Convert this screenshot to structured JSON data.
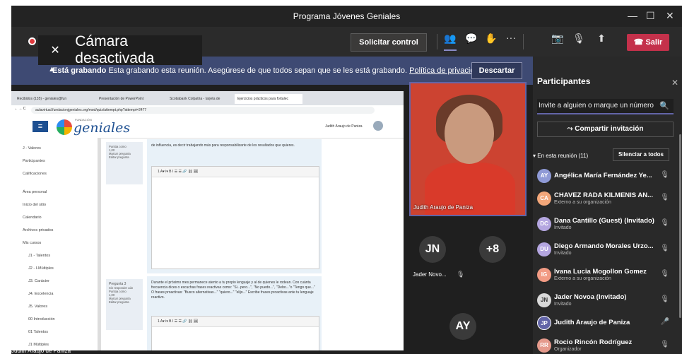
{
  "window": {
    "title": "Programa Jóvenes Geniales",
    "minimize": "—",
    "maximize": "☐",
    "close": "✕"
  },
  "camera_notice": "Cámara desactivada",
  "toolbar": {
    "request_control": "Solicitar control",
    "more": "···",
    "leave": "Salir"
  },
  "recording_banner": {
    "bold": "Está grabando",
    "text": "Esta grabando esta reunión. Asegúrese de que todos sepan que se les está grabando.",
    "link": "Política de privacidad",
    "dismiss": "Descartar"
  },
  "shared_screen": {
    "tabs": [
      "Recibidos (135) - geniales@fun",
      "Presentación de PowerPoint",
      "Scotiabank Colpatria - tarjeta de",
      "Ejercicios prácticos para fortalec"
    ],
    "url": "aulavirtual.fundacionjgeniales.org/mod/quiz/attempt.php?attempt=2477",
    "logo_top": "FUNDACIÓN",
    "logo": "geniales",
    "header_user": "Judith Araujo de Paniza",
    "sidebar": [
      "J - Valores",
      "Participantes",
      "Calificaciones",
      "Área personal",
      "Inicio del sitio",
      "Calendario",
      "Archivos privados",
      "Mis cursos",
      "J1 - Talentos",
      "J2 - I-Múltiples",
      "J3. Carácter",
      "J4. Excelencia",
      "J5. Valores",
      "00 Introducción",
      "01 Talentos",
      "J1 Múltiples"
    ],
    "q1_meta": [
      "Puntúa como",
      "1,00",
      "Marcar pregunta",
      "Editar pregunta"
    ],
    "q1_text": "de influencia, es decir trabajando más para responsabilizarte de los resultados que quieres.",
    "q2_meta": [
      "Pregunta 3",
      "Sin responder aún",
      "Puntúa como",
      "1,00",
      "Marcar pregunta",
      "Editar pregunta"
    ],
    "q2_text": "Durante el próximo mes permanece atento a tu propio lenguaje y al de quienes le rodean. Con cuánta frecuencia dices o escuchas frases reactivas como: \"Si...pero...\", \"No puedo...\", \"Debo...\"o \"Tengo que...\" O frases proactivas: \"Busco alternativas...\" \"quiero...\" \"elijo...\" Escribe frases proactivas ante tu lenguaje reactivo.",
    "editor_tools": "1   A▾   i▾   B   I   ☰   ☰   🔗   ⛓   🖼"
  },
  "presenter_label": "Judith Araujo de Paniza",
  "main_video": {
    "name": "Judith Araujo de Paniza"
  },
  "tiles": [
    {
      "initials": "JN",
      "color": "#3a3a3a",
      "name": "Jader Novo..."
    },
    {
      "initials": "+8",
      "color": "#3a3a3a"
    },
    {
      "initials": "AY",
      "color": "#3a3a3a"
    }
  ],
  "participants_panel": {
    "title": "Participantes",
    "invite_placeholder": "Invite a alguien o marque un número",
    "share_invite": "Compartir invitación",
    "section": "En esta reunión (11)",
    "mute_all": "Silenciar a todos",
    "people": [
      {
        "initials": "AY",
        "color": "#8f9ad6",
        "name": "Angélica María Fernández Ye...",
        "sub": ""
      },
      {
        "initials": "CA",
        "color": "#f3a77a",
        "name": "CHAVEZ RADA KILMENIS AN...",
        "sub": "Externo a su organización"
      },
      {
        "initials": "DC",
        "color": "#b4a6e0",
        "name": "Dana Cantillo (Guest) (Invitado)",
        "sub": "Invitado"
      },
      {
        "initials": "DU",
        "color": "#b4a6e0",
        "name": "Diego Armando Morales Urzo...",
        "sub": "Invitado"
      },
      {
        "initials": "IG",
        "color": "#f29b84",
        "name": "Ivana Lucia Mogollon Gomez",
        "sub": "Externo a su organización"
      },
      {
        "initials": "JN",
        "color": "#d9d9d9",
        "name": "Jader Novoa (Invitado)",
        "sub": "Invitado"
      },
      {
        "initials": "JP",
        "color": "#6264a7",
        "name": "Judith Araujo de Paniza",
        "sub": ""
      },
      {
        "initials": "RR",
        "color": "#e59a8c",
        "name": "Rocio Rincón Rodríguez",
        "sub": "Organizador"
      }
    ]
  }
}
